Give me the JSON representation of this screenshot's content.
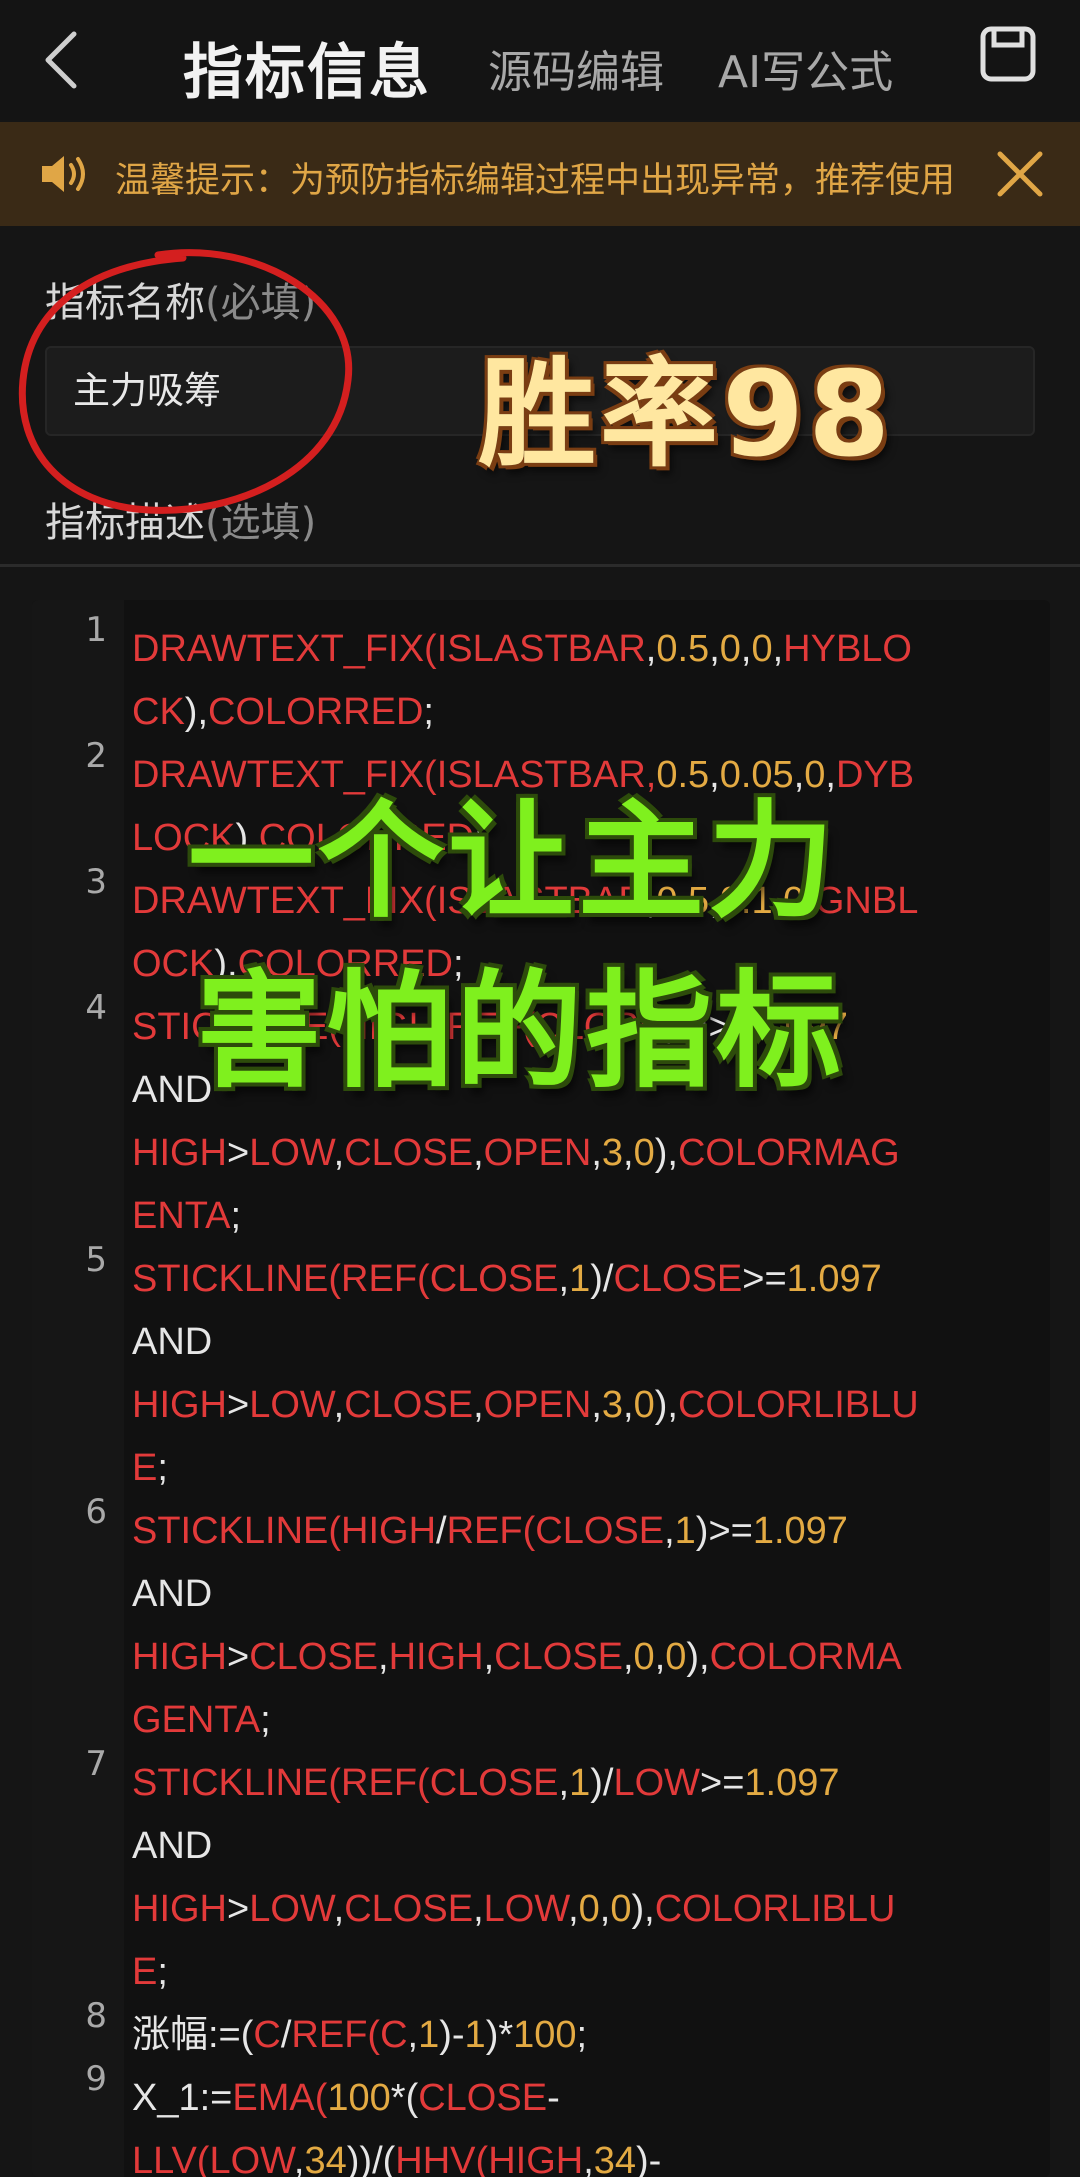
{
  "header": {
    "title": "指标信息",
    "tabs": [
      "源码编辑",
      "AI写公式"
    ]
  },
  "notice": {
    "text": "温馨提示：为预防指标编辑过程中出现异常，推荐使用"
  },
  "form": {
    "name_label": "指标名称",
    "name_hint": "(必填)",
    "name_value": "主力吸筹",
    "desc_label": "指标描述",
    "desc_hint": "(选填)"
  },
  "editor": {
    "line_numbers": [
      "1",
      "2",
      "3",
      "4",
      "5",
      "6",
      "7",
      "8",
      "9"
    ],
    "lines": [
      [
        [
          "DRAWTEXT_FIX(",
          "r"
        ],
        [
          "ISLASTBAR",
          "r"
        ],
        [
          ",",
          "w"
        ],
        [
          "0.5",
          "n"
        ],
        [
          ",",
          "w"
        ],
        [
          "0",
          "n"
        ],
        [
          ",",
          "w"
        ],
        [
          "0",
          "n"
        ],
        [
          ",",
          "w"
        ],
        [
          "HYBLO",
          "r"
        ]
      ],
      [
        [
          "CK",
          "r"
        ],
        [
          "),",
          "w"
        ],
        [
          "COLORRED",
          "r"
        ],
        [
          ";",
          "w"
        ]
      ],
      [
        [
          "DRAWTEXT_FIX(ISLASTBAR,",
          "r"
        ],
        [
          "0.5",
          "n"
        ],
        [
          ",",
          "w"
        ],
        [
          "0.05",
          "n"
        ],
        [
          ",",
          "w"
        ],
        [
          "0",
          "n"
        ],
        [
          ",",
          "w"
        ],
        [
          "DYB",
          "r"
        ]
      ],
      [
        [
          "LOCK",
          "r"
        ],
        [
          "),",
          "w"
        ],
        [
          "COLORRED",
          "r"
        ],
        [
          ";",
          "w"
        ]
      ],
      [
        [
          "DRAWTEXT_FIX(",
          "r"
        ],
        [
          "ISLASTBAR",
          "r"
        ],
        [
          ",",
          "w"
        ],
        [
          "0.5",
          "n"
        ],
        [
          ",",
          "w"
        ],
        [
          "0.1",
          "n"
        ],
        [
          ",",
          "w"
        ],
        [
          "0",
          "n"
        ],
        [
          ",",
          "w"
        ],
        [
          "GNBL",
          "r"
        ]
      ],
      [
        [
          "OCK",
          "r"
        ],
        [
          "),",
          "w"
        ],
        [
          "COLORRED",
          "r"
        ],
        [
          ";",
          "w"
        ]
      ],
      [
        [
          "STICKLINE(",
          "r"
        ],
        [
          "HIGH",
          "r"
        ],
        [
          "/",
          "w"
        ],
        [
          "REF(",
          "r"
        ],
        [
          "CLOSE",
          "r"
        ],
        [
          ",",
          "w"
        ],
        [
          "1",
          "n"
        ],
        [
          ")",
          "w"
        ],
        [
          ">=",
          "w"
        ],
        [
          "1.097",
          "n"
        ]
      ],
      [
        [
          "AND",
          "w"
        ]
      ],
      [
        [
          "HIGH",
          "r"
        ],
        [
          ">",
          "w"
        ],
        [
          "LOW",
          "r"
        ],
        [
          ",",
          "w"
        ],
        [
          "CLOSE",
          "r"
        ],
        [
          ",",
          "w"
        ],
        [
          "OPEN",
          "r"
        ],
        [
          ",",
          "w"
        ],
        [
          "3",
          "n"
        ],
        [
          ",",
          "w"
        ],
        [
          "0",
          "n"
        ],
        [
          "),",
          "w"
        ],
        [
          "COLORMAG",
          "r"
        ]
      ],
      [
        [
          "ENTA",
          "r"
        ],
        [
          ";",
          "w"
        ]
      ],
      [
        [
          "STICKLINE(",
          "r"
        ],
        [
          "REF(",
          "r"
        ],
        [
          "CLOSE",
          "r"
        ],
        [
          ",",
          "w"
        ],
        [
          "1",
          "n"
        ],
        [
          ")/",
          "w"
        ],
        [
          "CLOSE",
          "r"
        ],
        [
          ">=",
          "w"
        ],
        [
          "1.097",
          "n"
        ]
      ],
      [
        [
          "AND",
          "w"
        ]
      ],
      [
        [
          "HIGH",
          "r"
        ],
        [
          ">",
          "w"
        ],
        [
          "LOW",
          "r"
        ],
        [
          ",",
          "w"
        ],
        [
          "CLOSE",
          "r"
        ],
        [
          ",",
          "w"
        ],
        [
          "OPEN",
          "r"
        ],
        [
          ",",
          "w"
        ],
        [
          "3",
          "n"
        ],
        [
          ",",
          "w"
        ],
        [
          "0",
          "n"
        ],
        [
          "),",
          "w"
        ],
        [
          "COLORLIBLU",
          "r"
        ]
      ],
      [
        [
          "E",
          "r"
        ],
        [
          ";",
          "w"
        ]
      ],
      [
        [
          "STICKLINE(",
          "r"
        ],
        [
          "HIGH",
          "r"
        ],
        [
          "/",
          "w"
        ],
        [
          "REF(",
          "r"
        ],
        [
          "CLOSE",
          "r"
        ],
        [
          ",",
          "w"
        ],
        [
          "1",
          "n"
        ],
        [
          ")>=",
          "w"
        ],
        [
          "1.097",
          "n"
        ]
      ],
      [
        [
          "AND",
          "w"
        ]
      ],
      [
        [
          "HIGH",
          "r"
        ],
        [
          ">",
          "w"
        ],
        [
          "CLOSE",
          "r"
        ],
        [
          ",",
          "w"
        ],
        [
          "HIGH",
          "r"
        ],
        [
          ",",
          "w"
        ],
        [
          "CLOSE",
          "r"
        ],
        [
          ",",
          "w"
        ],
        [
          "0",
          "n"
        ],
        [
          ",",
          "w"
        ],
        [
          "0",
          "n"
        ],
        [
          "),",
          "w"
        ],
        [
          "COLORMA",
          "r"
        ]
      ],
      [
        [
          "GENTA",
          "r"
        ],
        [
          ";",
          "w"
        ]
      ],
      [
        [
          "STICKLINE(",
          "r"
        ],
        [
          "REF(",
          "r"
        ],
        [
          "CLOSE",
          "r"
        ],
        [
          ",",
          "w"
        ],
        [
          "1",
          "n"
        ],
        [
          ")/",
          "w"
        ],
        [
          "LOW",
          "r"
        ],
        [
          ">=",
          "w"
        ],
        [
          "1.097",
          "n"
        ]
      ],
      [
        [
          "AND",
          "w"
        ]
      ],
      [
        [
          "HIGH",
          "r"
        ],
        [
          ">",
          "w"
        ],
        [
          "LOW",
          "r"
        ],
        [
          ",",
          "w"
        ],
        [
          "CLOSE",
          "r"
        ],
        [
          ",",
          "w"
        ],
        [
          "LOW",
          "r"
        ],
        [
          ",",
          "w"
        ],
        [
          "0",
          "n"
        ],
        [
          ",",
          "w"
        ],
        [
          "0",
          "n"
        ],
        [
          "),",
          "w"
        ],
        [
          "COLORLIBLU",
          "r"
        ]
      ],
      [
        [
          "E",
          "r"
        ],
        [
          ";",
          "w"
        ]
      ],
      [
        [
          "涨幅:=(",
          "w"
        ],
        [
          "C",
          "r"
        ],
        [
          "/",
          "w"
        ],
        [
          "REF(",
          "r"
        ],
        [
          "C",
          "r"
        ],
        [
          ",",
          "w"
        ],
        [
          "1",
          "n"
        ],
        [
          ")-",
          "w"
        ],
        [
          "1",
          "n"
        ],
        [
          ")*",
          "w"
        ],
        [
          "100",
          "n"
        ],
        [
          ";",
          "w"
        ]
      ],
      [
        [
          "X_1:=",
          "w"
        ],
        [
          "EMA(",
          "r"
        ],
        [
          "100",
          "n"
        ],
        [
          "*(",
          "w"
        ],
        [
          "CLOSE",
          "r"
        ],
        [
          "-",
          "w"
        ]
      ],
      [
        [
          "LLV(",
          "r"
        ],
        [
          "LOW",
          "r"
        ],
        [
          ",",
          "w"
        ],
        [
          "34",
          "n"
        ],
        [
          "))/(",
          "w"
        ],
        [
          "HHV(",
          "r"
        ],
        [
          "HIGH",
          "r"
        ],
        [
          ",",
          "w"
        ],
        [
          "34",
          "n"
        ],
        [
          ")-",
          "w"
        ]
      ]
    ]
  },
  "overlay": {
    "win_rate": "胜率98",
    "slogan_line1": "一个让主力",
    "slogan_line2": "害怕的指标"
  }
}
